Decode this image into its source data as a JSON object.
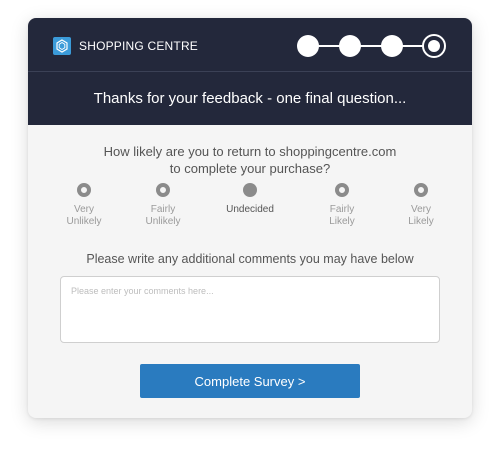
{
  "header": {
    "brand_name": "SHOPPING CENTRE",
    "brand_icon": "hexagon-logo-icon",
    "title": "Thanks for your feedback - one final question...",
    "progress": {
      "total_steps": 4,
      "current_step": 4
    }
  },
  "question": {
    "line1": "How likely are you to return to shoppingcentre.com",
    "line2": "to complete your purchase?",
    "options": [
      {
        "line1": "Very",
        "line2": "Unlikely",
        "selected": false
      },
      {
        "line1": "Fairly",
        "line2": "Unlikely",
        "selected": false
      },
      {
        "line1": "Undecided",
        "line2": "",
        "selected": true
      },
      {
        "line1": "Fairly",
        "line2": "Likely",
        "selected": false
      },
      {
        "line1": "Very",
        "line2": "Likely",
        "selected": false
      }
    ]
  },
  "comments": {
    "label": "Please write any additional comments you may have below",
    "placeholder": "Please enter your comments here...",
    "value": ""
  },
  "submit_label": "Complete Survey >",
  "colors": {
    "header_bg": "#23283b",
    "accent": "#2a7bbf",
    "logo": "#3b9bd9",
    "card_bg": "#f5f5f5"
  }
}
